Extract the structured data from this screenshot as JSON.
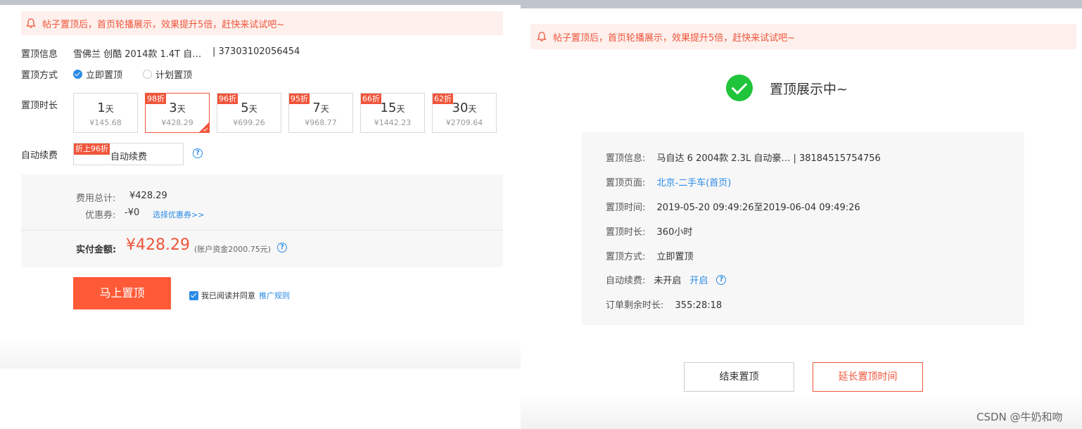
{
  "left": {
    "notice": "帖子置顶后，首页轮播展示，效果提升5倍，赶快来试试吧~",
    "info_label": "置顶信息",
    "info_value": "雪佛兰 创酷 2014款 1.4T 自…",
    "info_id": "| 37303102056454",
    "mode_label": "置顶方式",
    "mode_options": [
      "立即置顶",
      "计划置顶"
    ],
    "duration_label": "置顶时长",
    "durations": [
      {
        "num": "1",
        "unit": "天",
        "price": "¥145.68",
        "tag": ""
      },
      {
        "num": "3",
        "unit": "天",
        "price": "¥428.29",
        "tag": "98折"
      },
      {
        "num": "5",
        "unit": "天",
        "price": "¥699.26",
        "tag": "96折"
      },
      {
        "num": "7",
        "unit": "天",
        "price": "¥968.77",
        "tag": "95折"
      },
      {
        "num": "15",
        "unit": "天",
        "price": "¥1442.23",
        "tag": "66折"
      },
      {
        "num": "30",
        "unit": "天",
        "price": "¥2709.64",
        "tag": "62折"
      }
    ],
    "auto_label": "自动续费",
    "auto_tag": "折上96折",
    "auto_option": "自动续费",
    "fee_total_label": "费用总计:",
    "fee_total_value": "¥428.29",
    "coupon_label": "优惠券:",
    "coupon_value": "-¥0",
    "coupon_link": "选择优惠券>>",
    "pay_label": "实付金额:",
    "pay_amount": "¥428.29",
    "pay_balance": "(账户资金2000.75元)",
    "submit": "马上置顶",
    "agree_text": "我已阅读并同意",
    "agree_link": "推广规则",
    "help": "?"
  },
  "right": {
    "notice": "帖子置顶后，首页轮播展示，效果提升5倍，赶快来试试吧~",
    "status": "置顶展示中~",
    "rows": [
      {
        "k": "置顶信息:",
        "v": "马自达 6 2004款 2.3L 自动豪…   | 38184515754756"
      },
      {
        "k": "置顶页面:",
        "v": "北京-二手车(首页)"
      },
      {
        "k": "置顶时间:",
        "v": "2019-05-20 09:49:26至2019-06-04 09:49:26"
      },
      {
        "k": "置顶时长:",
        "v": "360小时"
      },
      {
        "k": "置顶方式:",
        "v": "立即置顶"
      },
      {
        "k": "自动续费:",
        "v": "未开启"
      },
      {
        "k": "订单剩余时长:",
        "v": "355:28:18"
      }
    ],
    "auto_link": "开启",
    "help": "?",
    "end_button": "结束置顶",
    "extend_button": "延长置顶时间",
    "watermark": "CSDN @牛奶和吻"
  },
  "colors": {
    "accent": "#f0553a",
    "primary_button": "#ff5a37",
    "link": "#2b8be6",
    "success": "#1fc43a"
  },
  "icons": [
    "bell-icon",
    "check-circle-icon",
    "help-icon",
    "checkbox-checked-icon",
    "radio-icon"
  ]
}
